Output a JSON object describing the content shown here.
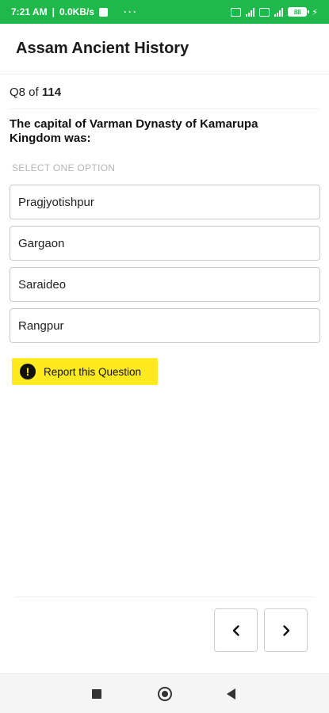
{
  "status_bar": {
    "time": "7:21 AM",
    "network_speed": "0.0KB/s",
    "overflow": "···",
    "battery_level": "88",
    "color": "#1fb84a"
  },
  "app": {
    "title": "Assam Ancient History"
  },
  "question": {
    "prefix": "Q8",
    "of_label": " of ",
    "total": "114",
    "text": "The capital of Varman Dynasty of Kamarupa Kingdom was:",
    "hint": "SELECT ONE OPTION"
  },
  "options": [
    "Pragjyotishpur",
    "Gargaon",
    "Saraideo",
    "Rangpur"
  ],
  "report": {
    "label": "Report this Question",
    "icon": "exclamation-circle-icon",
    "color": "#ffe91f"
  },
  "navigation": {
    "prev_icon": "chevron-left-icon",
    "next_icon": "chevron-right-icon"
  }
}
